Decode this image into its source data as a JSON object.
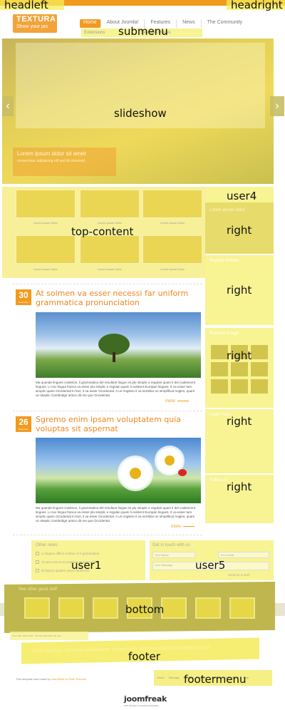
{
  "labels": {
    "headleft": "headleft",
    "headright": "headright",
    "submenu": "submenu",
    "slideshow": "slideshow",
    "top_content": "top-content",
    "user4": "user4",
    "right": "right",
    "user1": "user1",
    "user5": "user5",
    "bottom": "bottom",
    "footer": "footer",
    "footermenu": "footermenu"
  },
  "header": {
    "logo_title": "TEXTURA",
    "logo_tagline": "Show your jas",
    "menu": [
      "Home",
      "About Joomla!",
      "Features",
      "News",
      "The Community"
    ],
    "submenu": [
      "Extensions",
      "Example Pages"
    ]
  },
  "slideshow": {
    "caption_title": "Lorem ipsum dolor sit amet",
    "caption_text": "consectetur adipisicing elit sed do eiusmod",
    "prev": "‹",
    "next": "›"
  },
  "top_content": {
    "captions": [
      "Lorem Ipsum Dolor",
      "Lorem Ipsum Dolor",
      "Lorem Ipsum Dolor",
      "Lorem Ipsum Dolor",
      "Lorem Ipsum Dolor",
      "Lorem Ipsum Dolor"
    ]
  },
  "right": {
    "box1_title": "Lorem ipsum dolor",
    "box2_title": "Popular Articles",
    "box3_title": "Random Image",
    "box4_title": "Login Form",
    "box5_title": "Follow us"
  },
  "articles": [
    {
      "day": "30",
      "month": "November",
      "title": "At solmen va esser necessi far uniform grammatica pronunciation",
      "text": "Ma quande lingues coalesce, li grammatica del resultant lingue es plu simplic e regulari quam li del coalescent lingues. Li nov lingua franca va esser plu simplic e regulari quam li existent Europan lingues. It va esser tam simplic quam Occidental in fact, it va esser Occidental. A un Angleso it va semblar un simplificat Angles, quam un skeptic Cambridge amico dit me que Occidental.",
      "more": "more"
    },
    {
      "day": "26",
      "month": "November",
      "title": "Sgremo enim ipsam voluptatem quia voluptas sit aspernat",
      "text": "Ma quande lingues coalesce, li grammatica del resultant lingue es plu simplic e regulari quam li del coalescent lingues. Li nov lingua franca va esser plu simplic e regulari quam li existent Europan lingues. It va esser tam simplic quam Occidental in fact, it va esser Occidental. A un Angleso it va semblar un simplificat Angles, quam un skeptic Cambridge amico dit me que Occidental.",
      "more": "more"
    }
  ],
  "user1": {
    "title": "Other news",
    "items": [
      "Li lingues differe solmen in li grammatica",
      "At vero eos et accusamus et iusto odio",
      "Et harum quidem rerum facilis est"
    ]
  },
  "user5": {
    "title": "Get in touch with us",
    "name_placeholder": "Your Name",
    "email_placeholder": "Your Email",
    "message_placeholder": "Your Message",
    "send": "Send us a mail"
  },
  "bottom": {
    "title": "See other good stuff"
  },
  "footer": {
    "note": "You are not here. Some pictures by us.",
    "text": "Cras dapibus. Vivamus elementum semper nisi. Aenean vulputate eleifend tellus.",
    "credits_prefix": "This template was made by",
    "credits_brand": "Joomfreak",
    "credits_suffix": "& Pixeli Textures",
    "menu": [
      "Home",
      "Sitemap",
      "Contact",
      "Privacy",
      "Joomla",
      "Extensions",
      "Help"
    ],
    "brand": "joomfreak",
    "brand_sub": "web design & joomla templates"
  }
}
